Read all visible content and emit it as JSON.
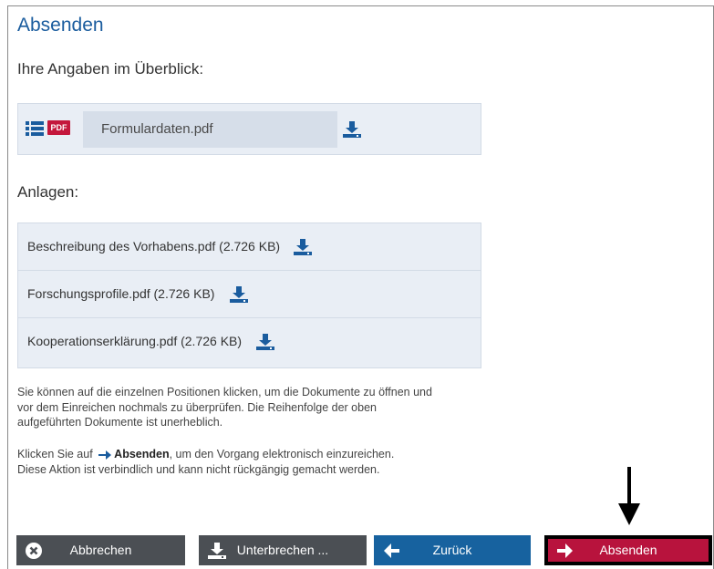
{
  "page": {
    "title": "Absenden",
    "overview_label": "Ihre Angaben im Überblick:",
    "summary": {
      "badge": "PDF",
      "file_name": "Formulardaten.pdf"
    },
    "attachments_label": "Anlagen:",
    "attachments": [
      {
        "name": "Beschreibung des Vorhabens.pdf (2.726 KB)"
      },
      {
        "name": "Forschungsprofile.pdf (2.726 KB)"
      },
      {
        "name": "Kooperationserklärung.pdf (2.726 KB)"
      }
    ],
    "info": {
      "line1": "Sie können auf die einzelnen Positionen klicken, um die Dokumente zu öffnen und",
      "line2": "vor dem Einreichen nochmals zu überprüfen. Die Reihenfolge der oben",
      "line3": "aufgeführten Dokumente ist unerheblich.",
      "hint_prefix": "Klicken Sie auf",
      "hint_bold": "Absenden",
      "hint_suffix": ", um den Vorgang elektronisch einzureichen.",
      "hint_line2": "Diese Aktion ist verbindlich und kann nicht rückgängig gemacht werden."
    }
  },
  "buttons": {
    "cancel": "Abbrechen",
    "pause": "Unterbrechen ...",
    "back": "Zurück",
    "send": "Absenden"
  },
  "colors": {
    "title": "#1a5c9e",
    "panel": "#e9eef5",
    "dark_button": "#4b4f54",
    "blue_button": "#17629f",
    "red_button": "#b8133d",
    "pdf_badge": "#c4173c"
  },
  "icons": {
    "list": "list-icon",
    "download": "download-icon",
    "close": "close-circle-icon",
    "arrow_left": "arrow-left-icon",
    "arrow_right": "arrow-right-icon",
    "pointer": "down-arrow-pointer"
  }
}
